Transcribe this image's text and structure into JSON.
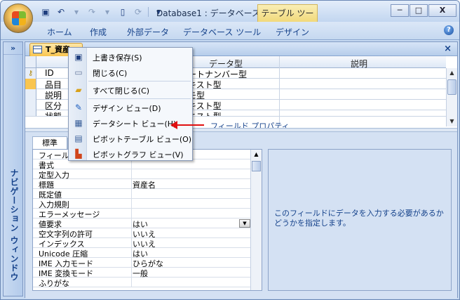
{
  "window": {
    "title": "Database1 : データベース ...",
    "context_tab": "テーブル ツール",
    "buttons": {
      "minimize": "─",
      "maximize": "□",
      "close": "X"
    }
  },
  "ribbon": {
    "tabs": [
      "ホーム",
      "作成",
      "外部データ",
      "データベース ツール",
      "デザイン"
    ],
    "help": "?"
  },
  "nav_pane": {
    "expand": "»",
    "label": "ナビゲーション ウィンドウ"
  },
  "document": {
    "tab_title": "T_資産",
    "close": "×",
    "headers": {
      "type": "データ型",
      "description": "説明"
    },
    "rows": [
      {
        "name": "ID",
        "type": "ートナンバー型"
      },
      {
        "name": "品目",
        "type": "キスト型"
      },
      {
        "name": "説明",
        "type": "モ型"
      },
      {
        "name": "区分",
        "type": "キスト型"
      },
      {
        "name": "状態",
        "type": "キスト型"
      }
    ],
    "field_properties_label": "フィールド プロパティ"
  },
  "properties": {
    "tab_label": "標準",
    "rows": [
      {
        "label": "フィールドサイズ",
        "value": ""
      },
      {
        "label": "書式",
        "value": ""
      },
      {
        "label": "定型入力",
        "value": ""
      },
      {
        "label": "標題",
        "value": "資産名"
      },
      {
        "label": "既定値",
        "value": ""
      },
      {
        "label": "入力規則",
        "value": ""
      },
      {
        "label": "エラーメッセージ",
        "value": ""
      },
      {
        "label": "値要求",
        "value": "はい"
      },
      {
        "label": "空文字列の許可",
        "value": "いいえ"
      },
      {
        "label": "インデックス",
        "value": "いいえ"
      },
      {
        "label": "Unicode 圧縮",
        "value": "はい"
      },
      {
        "label": "IME 入力モード",
        "value": "ひらがな"
      },
      {
        "label": "IME 変換モード",
        "value": "一般"
      },
      {
        "label": "ふりがな",
        "value": ""
      }
    ],
    "help_text": "このフィールドにデータを入力する必要があるかどうかを指定します。"
  },
  "context_menu": {
    "items": [
      {
        "icon": "save-icon",
        "label": "上書き保存(S)"
      },
      {
        "icon": "close-doc-icon",
        "label": "閉じる(C)"
      },
      {
        "icon": "folder-icon",
        "label": "すべて閉じる(C)"
      },
      {
        "icon": "design-view-icon",
        "label": "デザイン ビュー(D)"
      },
      {
        "icon": "datasheet-icon",
        "label": "データシート ビュー(H)"
      },
      {
        "icon": "pivot-table-icon",
        "label": "ピボットテーブル ビュー(O)"
      },
      {
        "icon": "pivot-chart-icon",
        "label": "ピボットグラフ ビュー(V)"
      }
    ]
  },
  "colors": {
    "accent": "#15428b",
    "annotation_arrow": "#e01010",
    "active_tab": "#f9c550"
  }
}
